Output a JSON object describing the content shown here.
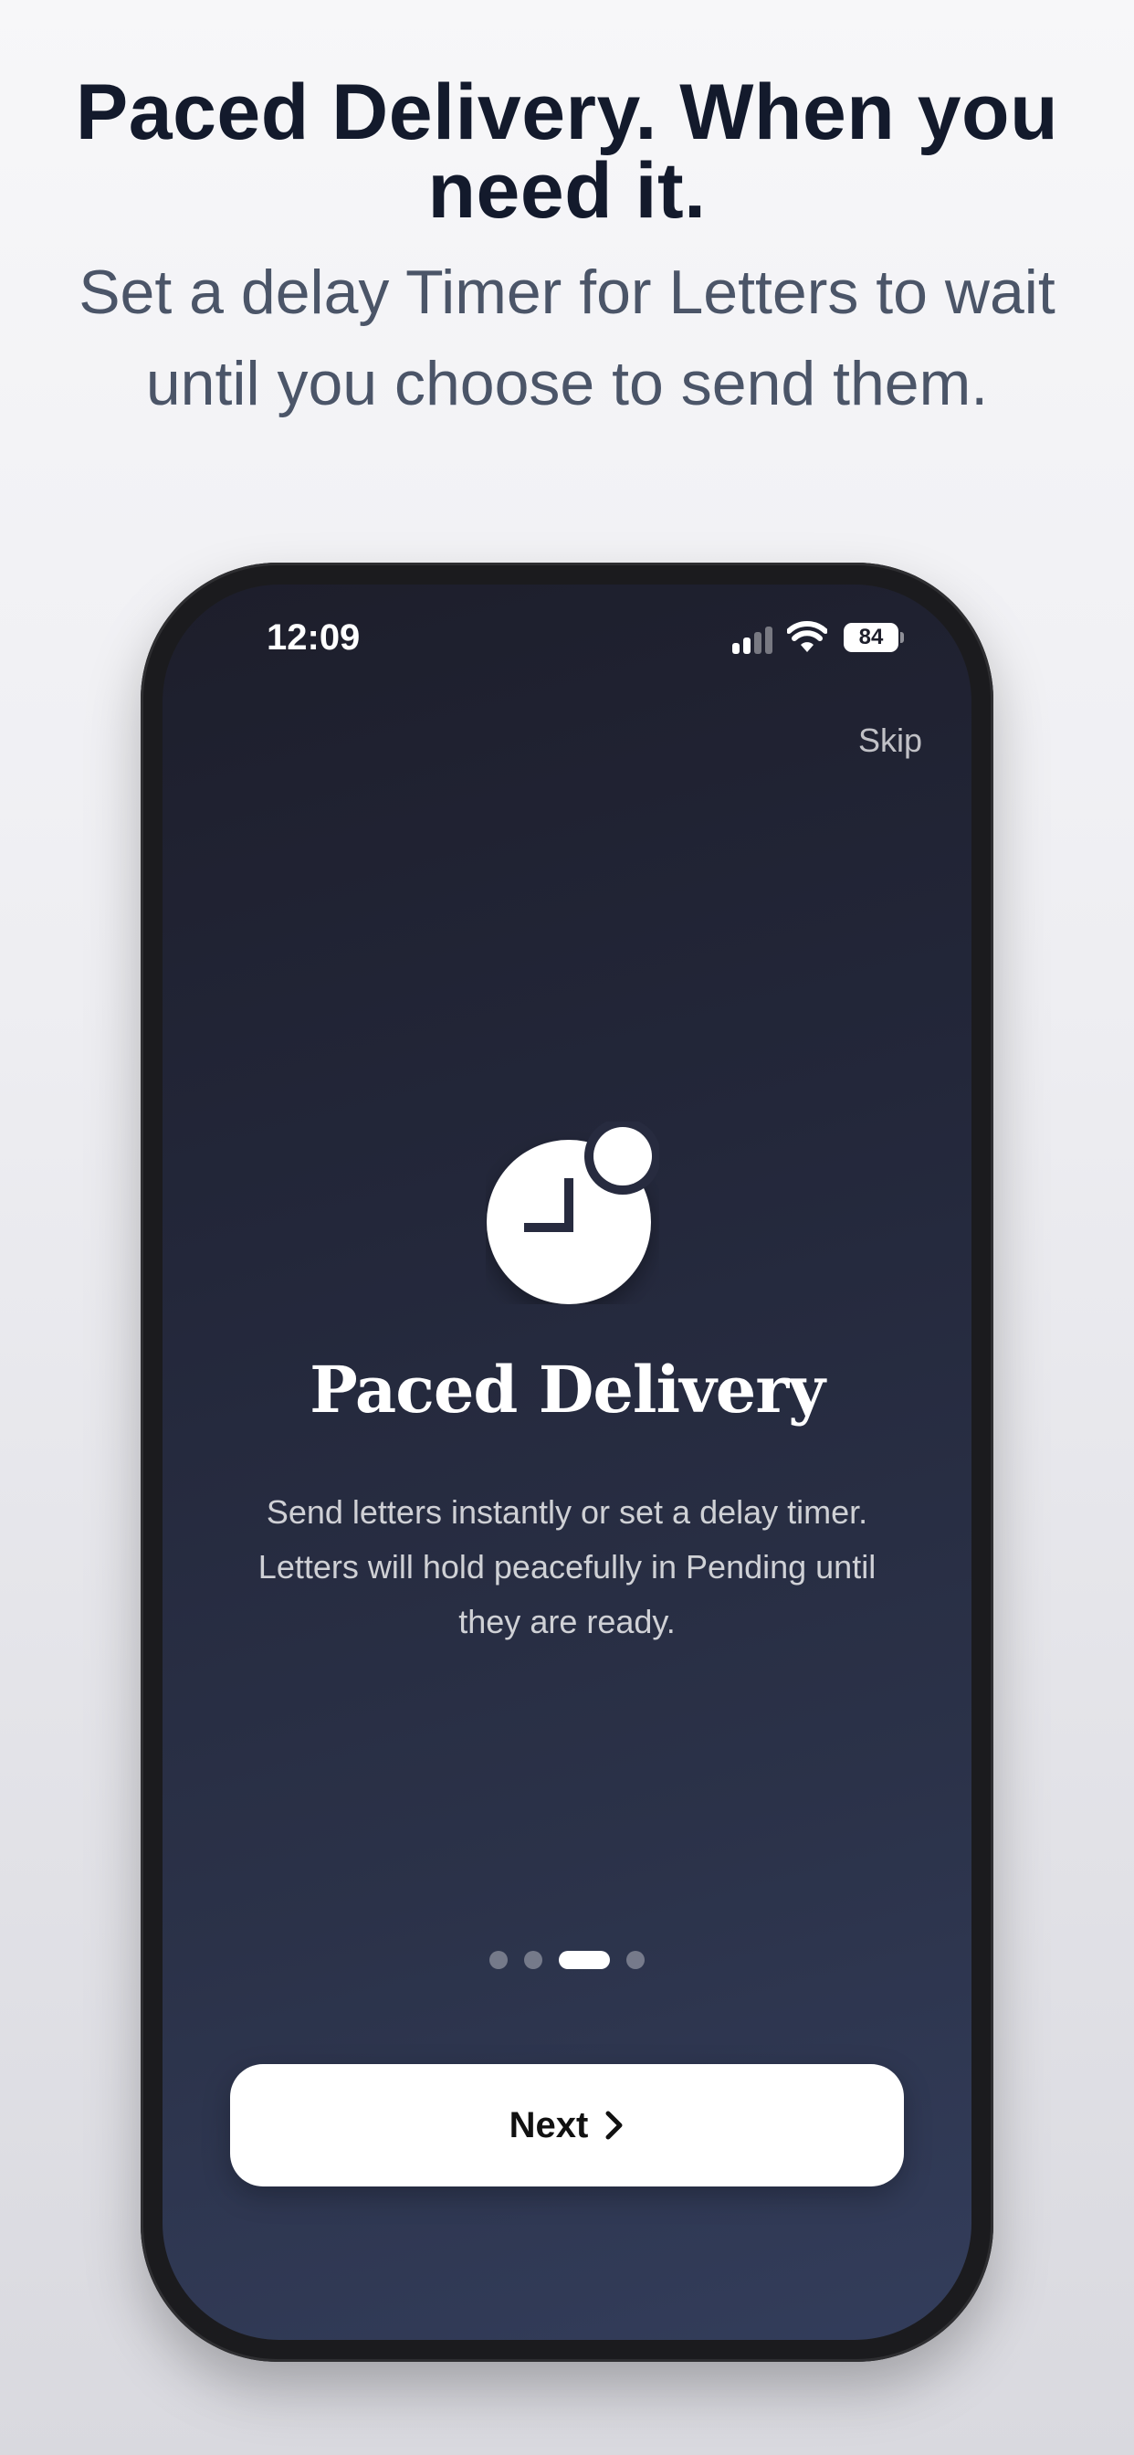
{
  "promo": {
    "title": "Paced Delivery. When you need it.",
    "subtitle": "Set a delay Timer for Letters to wait until you choose to send them."
  },
  "status_bar": {
    "time": "12:09",
    "battery": "84",
    "signal_icon": "cellular-signal-icon",
    "wifi_icon": "wifi-icon",
    "battery_icon": "battery-icon"
  },
  "onboarding": {
    "skip_label": "Skip",
    "feature_icon": "clock-icon",
    "feature_title": "Paced Delivery",
    "feature_description": "Send letters instantly or set a delay timer. Letters will hold peacefully in Pending until they are ready.",
    "page_count": 4,
    "active_page": 3,
    "next_label": "Next",
    "next_icon": "chevron-right-icon"
  },
  "colors": {
    "title": "#131a2c",
    "subtitle": "#4b5568",
    "screen_top": "#1d1e2b",
    "screen_bottom": "#333d5b",
    "button": "#ffffff"
  }
}
